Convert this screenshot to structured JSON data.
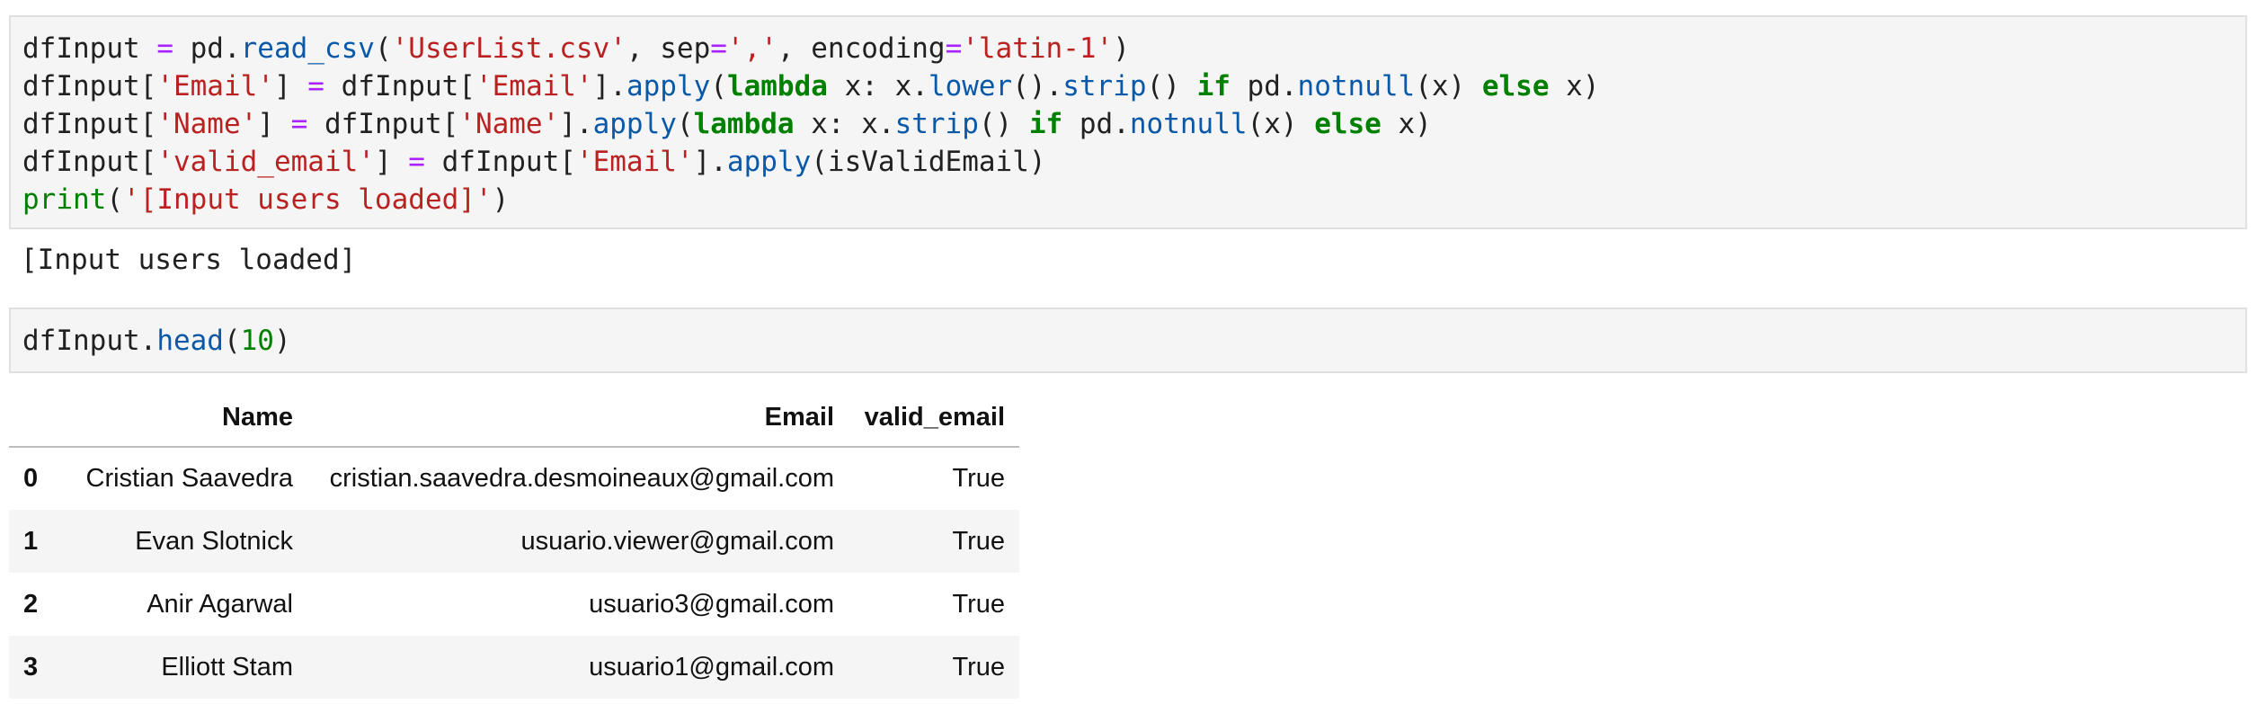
{
  "cells": [
    {
      "lines": [
        [
          {
            "t": "dfInput ",
            "c": ""
          },
          {
            "t": "=",
            "c": "op"
          },
          {
            "t": " pd.",
            "c": ""
          },
          {
            "t": "read_csv",
            "c": "fn"
          },
          {
            "t": "(",
            "c": ""
          },
          {
            "t": "'UserList.csv'",
            "c": "str"
          },
          {
            "t": ", sep",
            "c": ""
          },
          {
            "t": "=",
            "c": "op"
          },
          {
            "t": "','",
            "c": "str"
          },
          {
            "t": ", encoding",
            "c": ""
          },
          {
            "t": "=",
            "c": "op"
          },
          {
            "t": "'latin-1'",
            "c": "str"
          },
          {
            "t": ")",
            "c": ""
          }
        ],
        [
          {
            "t": "dfInput[",
            "c": ""
          },
          {
            "t": "'Email'",
            "c": "str"
          },
          {
            "t": "] ",
            "c": ""
          },
          {
            "t": "=",
            "c": "op"
          },
          {
            "t": " dfInput[",
            "c": ""
          },
          {
            "t": "'Email'",
            "c": "str"
          },
          {
            "t": "].",
            "c": ""
          },
          {
            "t": "apply",
            "c": "fn"
          },
          {
            "t": "(",
            "c": ""
          },
          {
            "t": "lambda",
            "c": "kw"
          },
          {
            "t": " x: x.",
            "c": ""
          },
          {
            "t": "lower",
            "c": "fn"
          },
          {
            "t": "().",
            "c": ""
          },
          {
            "t": "strip",
            "c": "fn"
          },
          {
            "t": "() ",
            "c": ""
          },
          {
            "t": "if",
            "c": "kw"
          },
          {
            "t": " pd.",
            "c": ""
          },
          {
            "t": "notnull",
            "c": "fn"
          },
          {
            "t": "(x) ",
            "c": ""
          },
          {
            "t": "else",
            "c": "kw"
          },
          {
            "t": " x)",
            "c": ""
          }
        ],
        [
          {
            "t": "dfInput[",
            "c": ""
          },
          {
            "t": "'Name'",
            "c": "str"
          },
          {
            "t": "] ",
            "c": ""
          },
          {
            "t": "=",
            "c": "op"
          },
          {
            "t": " dfInput[",
            "c": ""
          },
          {
            "t": "'Name'",
            "c": "str"
          },
          {
            "t": "].",
            "c": ""
          },
          {
            "t": "apply",
            "c": "fn"
          },
          {
            "t": "(",
            "c": ""
          },
          {
            "t": "lambda",
            "c": "kw"
          },
          {
            "t": " x: x.",
            "c": ""
          },
          {
            "t": "strip",
            "c": "fn"
          },
          {
            "t": "() ",
            "c": ""
          },
          {
            "t": "if",
            "c": "kw"
          },
          {
            "t": " pd.",
            "c": ""
          },
          {
            "t": "notnull",
            "c": "fn"
          },
          {
            "t": "(x) ",
            "c": ""
          },
          {
            "t": "else",
            "c": "kw"
          },
          {
            "t": " x)",
            "c": ""
          }
        ],
        [
          {
            "t": "dfInput[",
            "c": ""
          },
          {
            "t": "'valid_email'",
            "c": "str"
          },
          {
            "t": "] ",
            "c": ""
          },
          {
            "t": "=",
            "c": "op"
          },
          {
            "t": " dfInput[",
            "c": ""
          },
          {
            "t": "'Email'",
            "c": "str"
          },
          {
            "t": "].",
            "c": ""
          },
          {
            "t": "apply",
            "c": "fn"
          },
          {
            "t": "(isValidEmail)",
            "c": ""
          }
        ],
        [
          {
            "t": "print",
            "c": "bi"
          },
          {
            "t": "(",
            "c": ""
          },
          {
            "t": "'[Input users loaded]'",
            "c": "str"
          },
          {
            "t": ")",
            "c": ""
          }
        ]
      ],
      "output": "[Input users loaded]"
    },
    {
      "lines": [
        [
          {
            "t": "dfInput.",
            "c": ""
          },
          {
            "t": "head",
            "c": "fn"
          },
          {
            "t": "(",
            "c": ""
          },
          {
            "t": "10",
            "c": "num"
          },
          {
            "t": ")",
            "c": ""
          }
        ]
      ]
    }
  ],
  "table": {
    "columns": [
      "Name",
      "Email",
      "valid_email"
    ],
    "rows": [
      {
        "index": "0",
        "name": "Cristian Saavedra",
        "email": "cristian.saavedra.desmoineaux@gmail.com",
        "valid": "True"
      },
      {
        "index": "1",
        "name": "Evan Slotnick",
        "email": "usuario.viewer@gmail.com",
        "valid": "True"
      },
      {
        "index": "2",
        "name": "Anir Agarwal",
        "email": "usuario3@gmail.com",
        "valid": "True"
      },
      {
        "index": "3",
        "name": "Elliott Stam",
        "email": "usuario1@gmail.com",
        "valid": "True"
      }
    ]
  }
}
